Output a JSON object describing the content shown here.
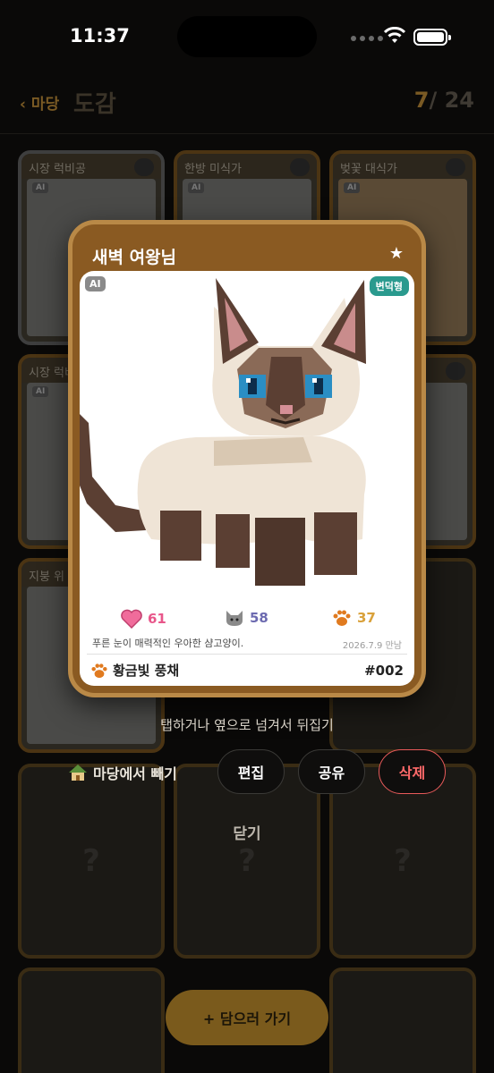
{
  "status_bar": {
    "time": "11:37"
  },
  "nav": {
    "back_label": "‹ 마당",
    "title": "도감",
    "counter_current": "7",
    "counter_total": "/ 24"
  },
  "tiles": [
    {
      "title": "시장 럭비공"
    },
    {
      "title": "한방 미식가"
    },
    {
      "title": "벚꽃 대식가"
    },
    {
      "title": "시장 럭비"
    },
    {
      "title": "지붕 위"
    }
  ],
  "unknown_mark": "?",
  "card": {
    "title": "새벽 여왕님",
    "star": "★",
    "ai_badge": "AI",
    "type_badge": "변덕형",
    "stats": {
      "hearts": "61",
      "cat": "58",
      "paw": "37"
    },
    "description": "푸른 눈이 매력적인 우아한 샴고양이.",
    "date": "2026.7.9 만남",
    "owner": "황금빛 풍채",
    "number": "#002"
  },
  "hint": "탭하거나 옆으로 넘겨서 뒤집기",
  "actions": {
    "remove_label": "마당에서 빼기",
    "edit_label": "편집",
    "share_label": "공유",
    "delete_label": "삭제"
  },
  "close_label": "닫기",
  "fab_label": "+ 담으러 가기",
  "colors": {
    "card_frame": "#8a5a22",
    "type_badge": "#2a9a8e",
    "delete": "#ff6a6a",
    "fab": "#7a5a1c"
  }
}
